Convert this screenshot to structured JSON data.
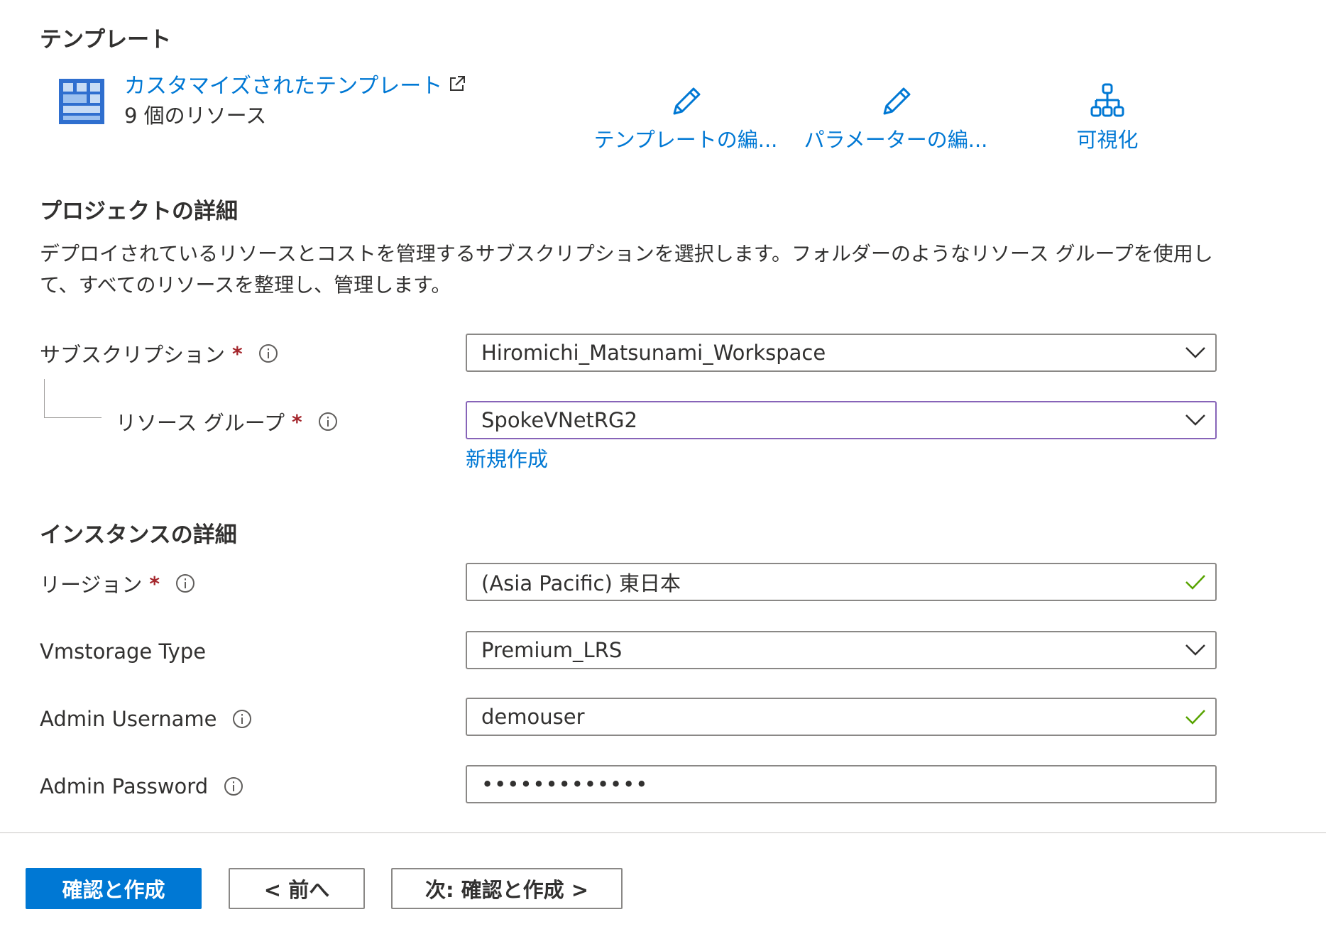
{
  "template": {
    "section_title": "テンプレート",
    "link_label": "カスタマイズされたテンプレート",
    "resource_count": "9 個のリソース",
    "actions": [
      {
        "label": "テンプレートの編...",
        "icon": "pencil-icon"
      },
      {
        "label": "パラメーターの編...",
        "icon": "pencil-icon"
      },
      {
        "label": "可視化",
        "icon": "hierarchy-icon"
      }
    ]
  },
  "project": {
    "section_title": "プロジェクトの詳細",
    "description": "デプロイされているリソースとコストを管理するサブスクリプションを選択します。フォルダーのようなリソース グループを使用して、すべてのリソースを整理し、管理します。",
    "subscription": {
      "label": "サブスクリプション",
      "required": "*",
      "value": "Hiromichi_Matsunami_Workspace"
    },
    "resource_group": {
      "label": "リソース グループ",
      "required": "*",
      "value": "SpokeVNetRG2",
      "create_new": "新規作成"
    }
  },
  "instance": {
    "section_title": "インスタンスの詳細",
    "region": {
      "label": "リージョン",
      "required": "*",
      "value": "(Asia Pacific) 東日本"
    },
    "vmstorage": {
      "label": "Vmstorage Type",
      "value": "Premium_LRS"
    },
    "admin_username": {
      "label": "Admin Username",
      "value": "demouser"
    },
    "admin_password": {
      "label": "Admin Password",
      "value": "•••••••••••••"
    }
  },
  "footer": {
    "review_create": "確認と作成",
    "previous": "< 前へ",
    "next": "次: 確認と作成 >"
  },
  "colors": {
    "accent": "#0078d4",
    "required": "#a4262c",
    "valid": "#57a300",
    "focus_border": "#8764b8"
  }
}
